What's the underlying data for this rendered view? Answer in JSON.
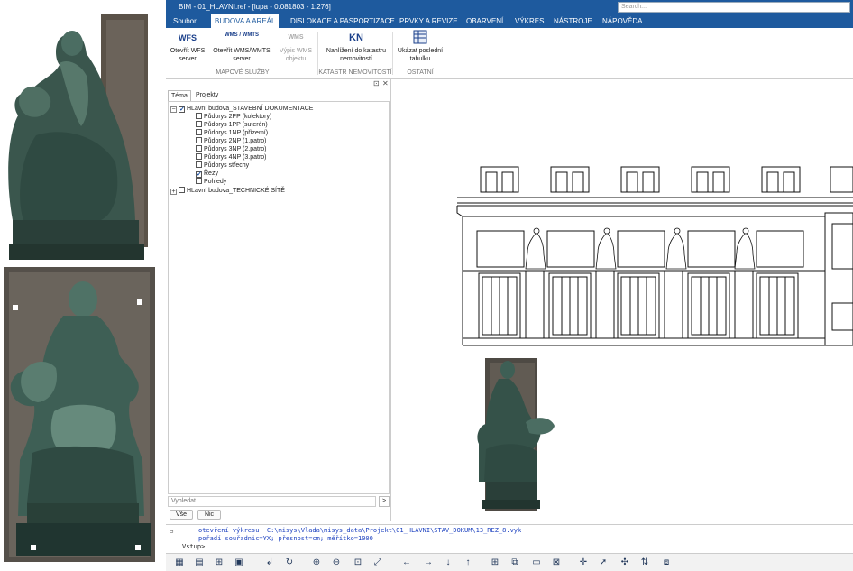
{
  "window": {
    "title": "BIM - 01_HLAVNI.ref - [lupa - 0.081803 - 1:276]",
    "search_placeholder": "Search..."
  },
  "menu": {
    "items": [
      "Soubor",
      "BUDOVA A AREÁL",
      "DISLOKACE A PASPORTIZACE",
      "PRVKY A REVIZE",
      "OBARVENÍ",
      "VÝKRES",
      "NÁSTROJE",
      "NÁPOVĚDA"
    ],
    "active": "BUDOVA A AREÁL"
  },
  "ribbon": {
    "buttons": [
      {
        "icon": "wfs-icon",
        "glyph": "WFS",
        "label_1": "Otevřít WFS",
        "label_2": "server",
        "enabled": true
      },
      {
        "icon": "wms-wmts-icon",
        "glyph": "WMS / WMTS",
        "label_1": "Otevřít WMS/WMTS",
        "label_2": "server",
        "enabled": true
      },
      {
        "icon": "wms-list-icon",
        "glyph": "WMS",
        "label_1": "Výpis WMS",
        "label_2": "objektu",
        "enabled": false
      },
      {
        "icon": "kn-icon",
        "glyph": "KN",
        "label_1": "Nahlížení do katastru",
        "label_2": "nemovitostí",
        "enabled": true
      },
      {
        "icon": "table-icon",
        "glyph": "",
        "label_1": "Ukázat poslední",
        "label_2": "tabulku",
        "enabled": true
      }
    ],
    "groups": [
      "MAPOVÉ SLUŽBY",
      "KATASTR NEMOVITOSTÍ",
      "OSTATNÍ"
    ]
  },
  "panel": {
    "pin_glyph": "⊡",
    "close_glyph": "✕",
    "tabs": [
      "Téma",
      "Projekty"
    ],
    "active_tab": "Téma",
    "tree": [
      {
        "label": "HLavní budova_STAVEBNÍ DOKUMENTACE",
        "level": 0,
        "expanded": true,
        "checked": true
      },
      {
        "label": "Půdorys 2PP (kolektory)",
        "level": 1,
        "checked": false
      },
      {
        "label": "Půdorys 1PP (suterén)",
        "level": 1,
        "checked": false
      },
      {
        "label": "Půdorys 1NP (přízemí)",
        "level": 1,
        "checked": false
      },
      {
        "label": "Půdorys 2NP (1.patro)",
        "level": 1,
        "checked": false
      },
      {
        "label": "Půdorys 3NP (2.patro)",
        "level": 1,
        "checked": false
      },
      {
        "label": "Půdorys 4NP (3.patro)",
        "level": 1,
        "checked": false
      },
      {
        "label": "Půdorys střechy",
        "level": 1,
        "checked": false
      },
      {
        "label": "Řezy",
        "level": 1,
        "checked": true
      },
      {
        "label": "Pohledy",
        "level": 1,
        "checked": false
      },
      {
        "label": "HLavní budova_TECHNICKÉ SÍTĚ",
        "level": 0,
        "expanded": false,
        "checked": false
      }
    ],
    "find_placeholder": "Vyhledat ...",
    "find_go": ">",
    "btn_all": "Vše",
    "btn_none": "Nic"
  },
  "console": {
    "prefix_glyph": "⊟",
    "line1": "otevření výkresu: C:\\misys\\Vlada\\misys_data\\Projekt\\01_HLAVNI\\STAV_DOKUM\\13_REZ_8.vyk",
    "line2": "pořadí souřadnic=YX; přesnost=cm; měřítko=1000",
    "prompt": "Vstup>"
  },
  "toolbar": {
    "tools": [
      {
        "name": "layers-tool-icon",
        "glyph": "▦"
      },
      {
        "name": "layer-manager-icon",
        "glyph": "▤"
      },
      {
        "name": "structure-icon",
        "glyph": "⊞"
      },
      {
        "name": "database-icon",
        "glyph": "▣"
      },
      {
        "name": "back-icon",
        "glyph": "↲"
      },
      {
        "name": "refresh-icon",
        "glyph": "↻"
      },
      {
        "name": "zoom-in-icon",
        "glyph": "⊕"
      },
      {
        "name": "zoom-out-icon",
        "glyph": "⊖"
      },
      {
        "name": "zoom-window-icon",
        "glyph": "⊡"
      },
      {
        "name": "zoom-extent-icon",
        "glyph": "⤢"
      },
      {
        "name": "pan-left-icon",
        "glyph": "←"
      },
      {
        "name": "pan-right-icon",
        "glyph": "→"
      },
      {
        "name": "pan-down-icon",
        "glyph": "↓"
      },
      {
        "name": "pan-up-icon",
        "glyph": "↑"
      },
      {
        "name": "grid-icon",
        "glyph": "⊞"
      },
      {
        "name": "select-window-icon",
        "glyph": "⧉"
      },
      {
        "name": "rectangle-icon",
        "glyph": "▭"
      },
      {
        "name": "clear-selection-icon",
        "glyph": "⊠"
      },
      {
        "name": "crosshair-icon",
        "glyph": "✛"
      },
      {
        "name": "pointer-icon",
        "glyph": "➚"
      },
      {
        "name": "move-icon",
        "glyph": "✣"
      },
      {
        "name": "mirror-icon",
        "glyph": "⇅"
      },
      {
        "name": "copy-icon",
        "glyph": "⧈"
      }
    ]
  },
  "colors": {
    "title_bar": "#1e5a9e",
    "bronze_dark": "#2f4a42",
    "bronze_mid": "#4b6d62",
    "bronze_light": "#7c9a8e"
  }
}
